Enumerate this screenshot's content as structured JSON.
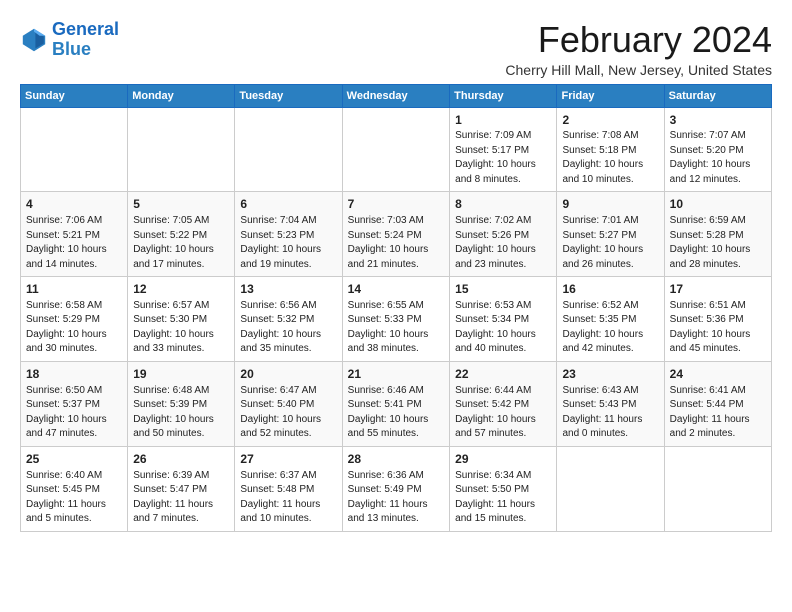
{
  "logo": {
    "line1": "General",
    "line2": "Blue"
  },
  "title": "February 2024",
  "location": "Cherry Hill Mall, New Jersey, United States",
  "days_of_week": [
    "Sunday",
    "Monday",
    "Tuesday",
    "Wednesday",
    "Thursday",
    "Friday",
    "Saturday"
  ],
  "weeks": [
    [
      {
        "day": "",
        "info": ""
      },
      {
        "day": "",
        "info": ""
      },
      {
        "day": "",
        "info": ""
      },
      {
        "day": "",
        "info": ""
      },
      {
        "day": "1",
        "info": "Sunrise: 7:09 AM\nSunset: 5:17 PM\nDaylight: 10 hours\nand 8 minutes."
      },
      {
        "day": "2",
        "info": "Sunrise: 7:08 AM\nSunset: 5:18 PM\nDaylight: 10 hours\nand 10 minutes."
      },
      {
        "day": "3",
        "info": "Sunrise: 7:07 AM\nSunset: 5:20 PM\nDaylight: 10 hours\nand 12 minutes."
      }
    ],
    [
      {
        "day": "4",
        "info": "Sunrise: 7:06 AM\nSunset: 5:21 PM\nDaylight: 10 hours\nand 14 minutes."
      },
      {
        "day": "5",
        "info": "Sunrise: 7:05 AM\nSunset: 5:22 PM\nDaylight: 10 hours\nand 17 minutes."
      },
      {
        "day": "6",
        "info": "Sunrise: 7:04 AM\nSunset: 5:23 PM\nDaylight: 10 hours\nand 19 minutes."
      },
      {
        "day": "7",
        "info": "Sunrise: 7:03 AM\nSunset: 5:24 PM\nDaylight: 10 hours\nand 21 minutes."
      },
      {
        "day": "8",
        "info": "Sunrise: 7:02 AM\nSunset: 5:26 PM\nDaylight: 10 hours\nand 23 minutes."
      },
      {
        "day": "9",
        "info": "Sunrise: 7:01 AM\nSunset: 5:27 PM\nDaylight: 10 hours\nand 26 minutes."
      },
      {
        "day": "10",
        "info": "Sunrise: 6:59 AM\nSunset: 5:28 PM\nDaylight: 10 hours\nand 28 minutes."
      }
    ],
    [
      {
        "day": "11",
        "info": "Sunrise: 6:58 AM\nSunset: 5:29 PM\nDaylight: 10 hours\nand 30 minutes."
      },
      {
        "day": "12",
        "info": "Sunrise: 6:57 AM\nSunset: 5:30 PM\nDaylight: 10 hours\nand 33 minutes."
      },
      {
        "day": "13",
        "info": "Sunrise: 6:56 AM\nSunset: 5:32 PM\nDaylight: 10 hours\nand 35 minutes."
      },
      {
        "day": "14",
        "info": "Sunrise: 6:55 AM\nSunset: 5:33 PM\nDaylight: 10 hours\nand 38 minutes."
      },
      {
        "day": "15",
        "info": "Sunrise: 6:53 AM\nSunset: 5:34 PM\nDaylight: 10 hours\nand 40 minutes."
      },
      {
        "day": "16",
        "info": "Sunrise: 6:52 AM\nSunset: 5:35 PM\nDaylight: 10 hours\nand 42 minutes."
      },
      {
        "day": "17",
        "info": "Sunrise: 6:51 AM\nSunset: 5:36 PM\nDaylight: 10 hours\nand 45 minutes."
      }
    ],
    [
      {
        "day": "18",
        "info": "Sunrise: 6:50 AM\nSunset: 5:37 PM\nDaylight: 10 hours\nand 47 minutes."
      },
      {
        "day": "19",
        "info": "Sunrise: 6:48 AM\nSunset: 5:39 PM\nDaylight: 10 hours\nand 50 minutes."
      },
      {
        "day": "20",
        "info": "Sunrise: 6:47 AM\nSunset: 5:40 PM\nDaylight: 10 hours\nand 52 minutes."
      },
      {
        "day": "21",
        "info": "Sunrise: 6:46 AM\nSunset: 5:41 PM\nDaylight: 10 hours\nand 55 minutes."
      },
      {
        "day": "22",
        "info": "Sunrise: 6:44 AM\nSunset: 5:42 PM\nDaylight: 10 hours\nand 57 minutes."
      },
      {
        "day": "23",
        "info": "Sunrise: 6:43 AM\nSunset: 5:43 PM\nDaylight: 11 hours\nand 0 minutes."
      },
      {
        "day": "24",
        "info": "Sunrise: 6:41 AM\nSunset: 5:44 PM\nDaylight: 11 hours\nand 2 minutes."
      }
    ],
    [
      {
        "day": "25",
        "info": "Sunrise: 6:40 AM\nSunset: 5:45 PM\nDaylight: 11 hours\nand 5 minutes."
      },
      {
        "day": "26",
        "info": "Sunrise: 6:39 AM\nSunset: 5:47 PM\nDaylight: 11 hours\nand 7 minutes."
      },
      {
        "day": "27",
        "info": "Sunrise: 6:37 AM\nSunset: 5:48 PM\nDaylight: 11 hours\nand 10 minutes."
      },
      {
        "day": "28",
        "info": "Sunrise: 6:36 AM\nSunset: 5:49 PM\nDaylight: 11 hours\nand 13 minutes."
      },
      {
        "day": "29",
        "info": "Sunrise: 6:34 AM\nSunset: 5:50 PM\nDaylight: 11 hours\nand 15 minutes."
      },
      {
        "day": "",
        "info": ""
      },
      {
        "day": "",
        "info": ""
      }
    ]
  ]
}
